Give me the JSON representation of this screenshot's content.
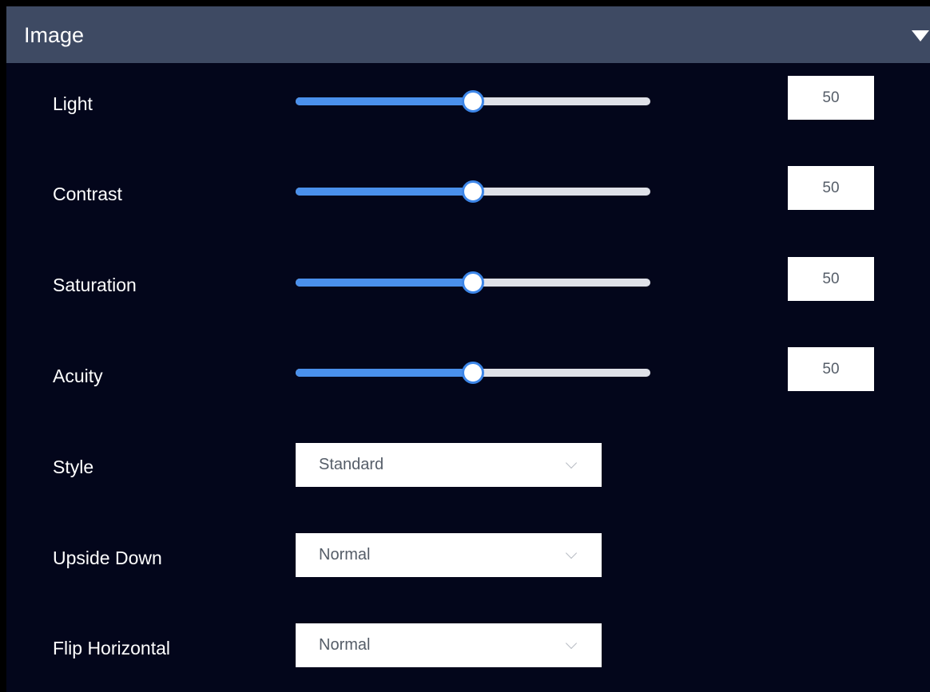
{
  "panel": {
    "title": "Image",
    "collapse_icon": "triangle-down-icon"
  },
  "colors": {
    "header_bg": "#3e4a63",
    "panel_bg": "#03061b",
    "slider_fill": "#4a90ec",
    "slider_track": "#dfe1e8"
  },
  "sliders": [
    {
      "label": "Light",
      "value": "50",
      "level_percent": 50
    },
    {
      "label": "Contrast",
      "value": "50",
      "level_percent": 50
    },
    {
      "label": "Saturation",
      "value": "50",
      "level_percent": 50
    },
    {
      "label": "Acuity",
      "value": "50",
      "level_percent": 50
    }
  ],
  "selects": [
    {
      "label": "Style",
      "value": "Standard",
      "icon": "chevron-down-icon"
    },
    {
      "label": "Upside Down",
      "value": "Normal",
      "icon": "chevron-down-icon"
    },
    {
      "label": "Flip Horizontal",
      "value": "Normal",
      "icon": "chevron-down-icon"
    }
  ]
}
